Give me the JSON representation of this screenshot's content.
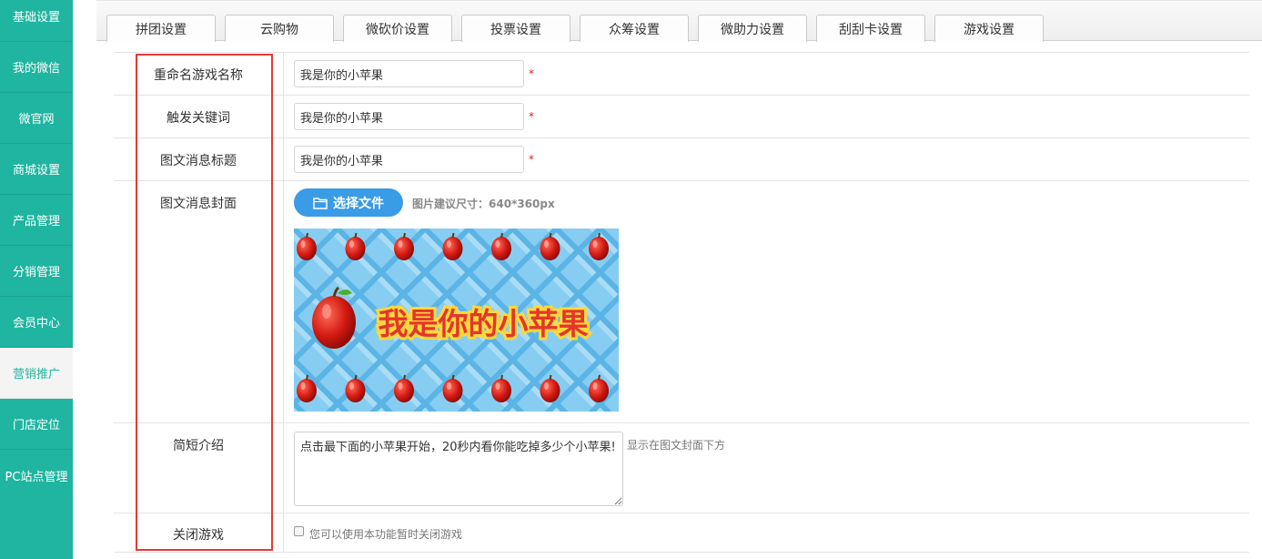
{
  "sidebar": {
    "items": [
      {
        "label": "基础设置"
      },
      {
        "label": "我的微信"
      },
      {
        "label": "微官网"
      },
      {
        "label": "商城设置"
      },
      {
        "label": "产品管理"
      },
      {
        "label": "分销管理"
      },
      {
        "label": "会员中心"
      },
      {
        "label": "营销推广"
      },
      {
        "label": "门店定位"
      },
      {
        "label": "PC站点管理"
      }
    ],
    "active": "营销推广"
  },
  "tabs": [
    {
      "label": "拼团设置"
    },
    {
      "label": "云购物"
    },
    {
      "label": "微砍价设置"
    },
    {
      "label": "投票设置"
    },
    {
      "label": "众筹设置"
    },
    {
      "label": "微助力设置"
    },
    {
      "label": "刮刮卡设置"
    },
    {
      "label": "游戏设置"
    }
  ],
  "form": {
    "rename_label": "重命名游戏名称",
    "rename_value": "我是你的小苹果",
    "keyword_label": "触发关键词",
    "keyword_value": "我是你的小苹果",
    "title_label": "图文消息标题",
    "title_value": "我是你的小苹果",
    "required_mark": "*",
    "cover_label": "图文消息封面",
    "file_button": "选择文件",
    "cover_hint": "图片建议尺寸：640*360px",
    "cover_text": "我是你的小苹果",
    "intro_label": "简短介绍",
    "intro_value": "点击最下面的小苹果开始，20秒内看你能吃掉多少个小苹果!",
    "intro_hint": "显示在图文封面下方",
    "close_label": "关闭游戏",
    "close_hint": "您可以使用本功能暂时关闭游戏",
    "close_checked": false
  },
  "colors": {
    "sidebar_bg": "#1fb5a0",
    "accent_blue": "#3a9be6",
    "highlight_red": "#e53935"
  }
}
